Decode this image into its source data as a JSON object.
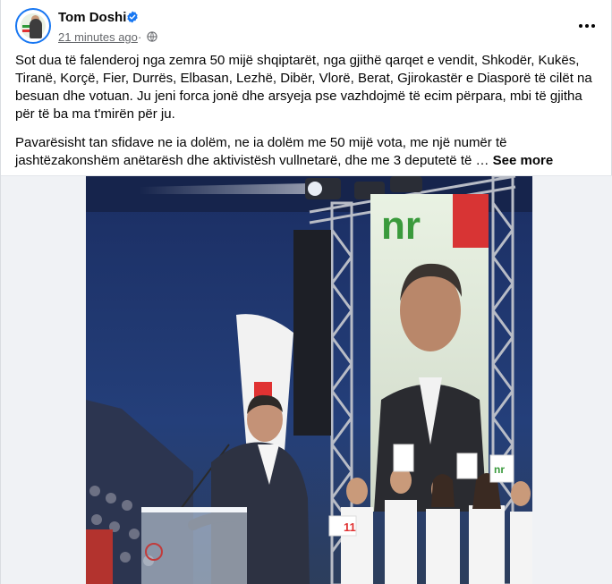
{
  "post": {
    "author": "Tom Doshi",
    "time": "21 minutes ago",
    "text": {
      "paragraph_1": "Sot dua të falenderoj nga zemra 50 mijë shqiptarët, nga gjithë qarqet e vendit, Shkodër, Kukës, Tiranë, Korçë, Fier, Durrës, Elbasan, Lezhë, Dibër, Vlorë, Berat, Gjirokastër e Diasporë të cilët na besuan dhe votuan. Ju jeni forca jonë dhe arsyeja pse vazhdojmë të ecim përpara, mbi të gjitha për të ba ma t'mirën për ju.",
      "paragraph_2": "Pavarësisht tan sfidave ne ia dolëm, ne ia dolëm me 50 mijë vota, me një numër të jashtëzakonshëm anëtarësh dhe aktivistësh vullnetarë, dhe me 3 deputetë të …",
      "see_more": "See more"
    },
    "photo": {
      "banner_text": "11",
      "screen_text": "nr",
      "sign_text": "11"
    }
  },
  "icons": {
    "verified": "verified-badge-icon",
    "globe": "globe-icon",
    "more": "more-options-icon"
  },
  "colors": {
    "brand_blue": "#1877f2",
    "text_primary": "#050505",
    "text_secondary": "#65676b",
    "party_red": "#e03232",
    "party_green": "#2e9a3a"
  }
}
